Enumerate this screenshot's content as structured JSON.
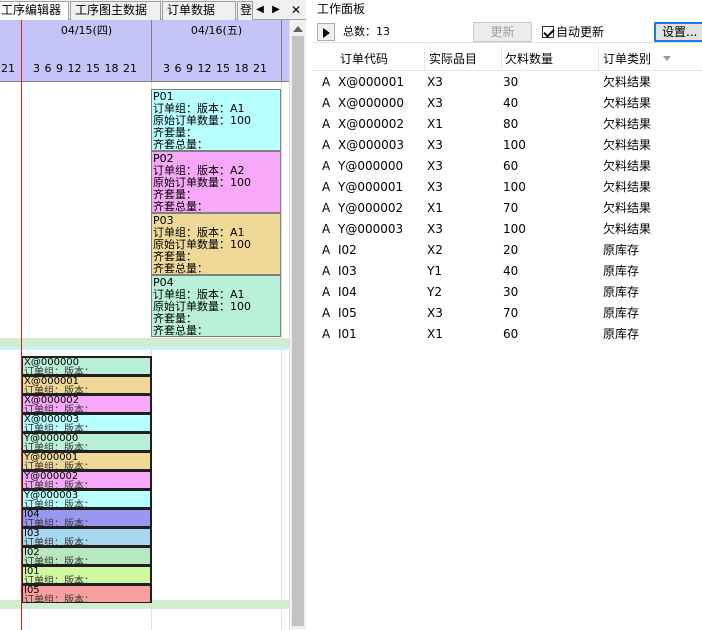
{
  "tabs": [
    {
      "label": "工序编辑器",
      "active": true
    },
    {
      "label": "工序图主数据",
      "active": false
    },
    {
      "label": "订单数据",
      "active": false
    },
    {
      "label": "登",
      "active": false
    }
  ],
  "tab_nav": {
    "prev": "◀",
    "next": "▶",
    "close": "✕"
  },
  "gantt": {
    "days": [
      "04/15(四)",
      "04/16(五)"
    ],
    "hours_partial": "21",
    "hours": "3  6  9 12 15 18 21",
    "cards": [
      {
        "title": "P01",
        "line1": "订单组：版本：A1",
        "line2": "原始订单数量：100",
        "line3": "齐套量：",
        "line4": "齐套总量：",
        "color": "#b8ffff"
      },
      {
        "title": "P02",
        "line1": "订单组：版本：A2",
        "line2": "原始订单数量：100",
        "line3": "齐套量：",
        "line4": "齐套总量：",
        "color": "#f8a8f8"
      },
      {
        "title": "P03",
        "line1": "订单组：版本：A1",
        "line2": "原始订单数量：100",
        "line3": "齐套量：",
        "line4": "齐套总量：",
        "color": "#f0d898"
      },
      {
        "title": "P04",
        "line1": "订单组：版本：A1",
        "line2": "原始订单数量：100",
        "line3": "齐套量：",
        "line4": "齐套总量：",
        "color": "#b8f0d8"
      }
    ],
    "bars": [
      {
        "label": "X@000000",
        "sub": "订单组：版本：",
        "color": "#b8f0d8"
      },
      {
        "label": "X@000001",
        "sub": "订单组：版本：",
        "color": "#f0d898"
      },
      {
        "label": "X@000002",
        "sub": "订单组：版本：",
        "color": "#f8a8f8"
      },
      {
        "label": "X@000003",
        "sub": "订单组：版本：",
        "color": "#b8ffff"
      },
      {
        "label": "Y@000000",
        "sub": "订单组：版本：",
        "color": "#b8f0d8"
      },
      {
        "label": "Y@000001",
        "sub": "订单组：版本：",
        "color": "#f0d898"
      },
      {
        "label": "Y@000002",
        "sub": "订单组：版本：",
        "color": "#f8a8f8"
      },
      {
        "label": "Y@000003",
        "sub": "订单组：版本：",
        "color": "#b8ffff"
      },
      {
        "label": "I04",
        "sub": "订单组：版本：",
        "color": "#9898f0"
      },
      {
        "label": "I03",
        "sub": "订单组：版本：",
        "color": "#a8d8f0"
      },
      {
        "label": "I02",
        "sub": "订单组：版本：",
        "color": "#b8e8c0"
      },
      {
        "label": "I01",
        "sub": "订单组：版本：",
        "color": "#d0f8a0"
      },
      {
        "label": "I05",
        "sub": "订单组：版本：",
        "color": "#f8a0a0"
      }
    ]
  },
  "panel": {
    "title": "工作面板",
    "total_label": "总数：13",
    "refresh_label": "更新",
    "auto_update_label": "自动更新",
    "auto_update_checked": true,
    "settings_label": "设置..."
  },
  "table": {
    "headers": [
      "订单代码",
      "实际品目",
      "欠料数量",
      "订单类别"
    ],
    "rows": [
      {
        "mark": "A",
        "code": "X@000001",
        "item": "X3",
        "qty": "30",
        "type": "欠料结果"
      },
      {
        "mark": "A",
        "code": "X@000000",
        "item": "X3",
        "qty": "40",
        "type": "欠料结果"
      },
      {
        "mark": "A",
        "code": "X@000002",
        "item": "X1",
        "qty": "80",
        "type": "欠料结果"
      },
      {
        "mark": "A",
        "code": "X@000003",
        "item": "X3",
        "qty": "100",
        "type": "欠料结果"
      },
      {
        "mark": "A",
        "code": "Y@000000",
        "item": "X3",
        "qty": "60",
        "type": "欠料结果"
      },
      {
        "mark": "A",
        "code": "Y@000001",
        "item": "X3",
        "qty": "100",
        "type": "欠料结果"
      },
      {
        "mark": "A",
        "code": "Y@000002",
        "item": "X1",
        "qty": "70",
        "type": "欠料结果"
      },
      {
        "mark": "A",
        "code": "Y@000003",
        "item": "X3",
        "qty": "100",
        "type": "欠料结果"
      },
      {
        "mark": "A",
        "code": "I02",
        "item": "X2",
        "qty": "20",
        "type": "原库存"
      },
      {
        "mark": "A",
        "code": "I03",
        "item": "Y1",
        "qty": "40",
        "type": "原库存"
      },
      {
        "mark": "A",
        "code": "I04",
        "item": "Y2",
        "qty": "30",
        "type": "原库存"
      },
      {
        "mark": "A",
        "code": "I05",
        "item": "X3",
        "qty": "70",
        "type": "原库存"
      },
      {
        "mark": "A",
        "code": "I01",
        "item": "X1",
        "qty": "60",
        "type": "原库存"
      }
    ]
  }
}
